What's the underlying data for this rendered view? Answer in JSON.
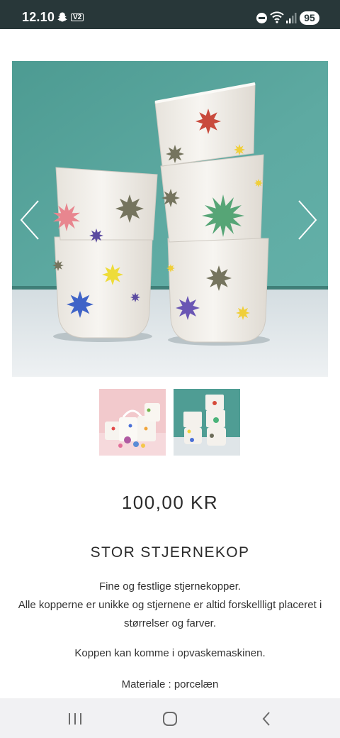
{
  "status_bar": {
    "time": "12.10",
    "tv2_label": "V2",
    "battery": "95",
    "icons": [
      "snapchat-icon",
      "tv2-icon",
      "do-not-disturb-icon",
      "wifi-icon",
      "signal-icon",
      "battery-icon"
    ]
  },
  "gallery": {
    "main_image_alt": "Stjernekopper",
    "thumbnail_count": 2,
    "icons": [
      "chevron-left-icon",
      "chevron-right-icon"
    ]
  },
  "product": {
    "price": "100,00 KR",
    "title": "STOR STJERNEKOP",
    "description_line1": "Fine og festlige stjernekopper.",
    "description_line2": "Alle kopperne er unikke og stjernene er altid forskellligt placeret i størrelser og farver.",
    "description_dishwasher": "Koppen kan komme i opvaskemaskinen.",
    "description_material": "Materiale : porcelæn"
  },
  "nav_bar": {
    "icons": [
      "recents-icon",
      "home-icon",
      "back-icon"
    ]
  },
  "colors": {
    "status_bar_bg": "#283739",
    "image_bg": "#5aa39a",
    "nav_bar_bg": "#f1f1f3",
    "text": "#2b2b2b"
  }
}
